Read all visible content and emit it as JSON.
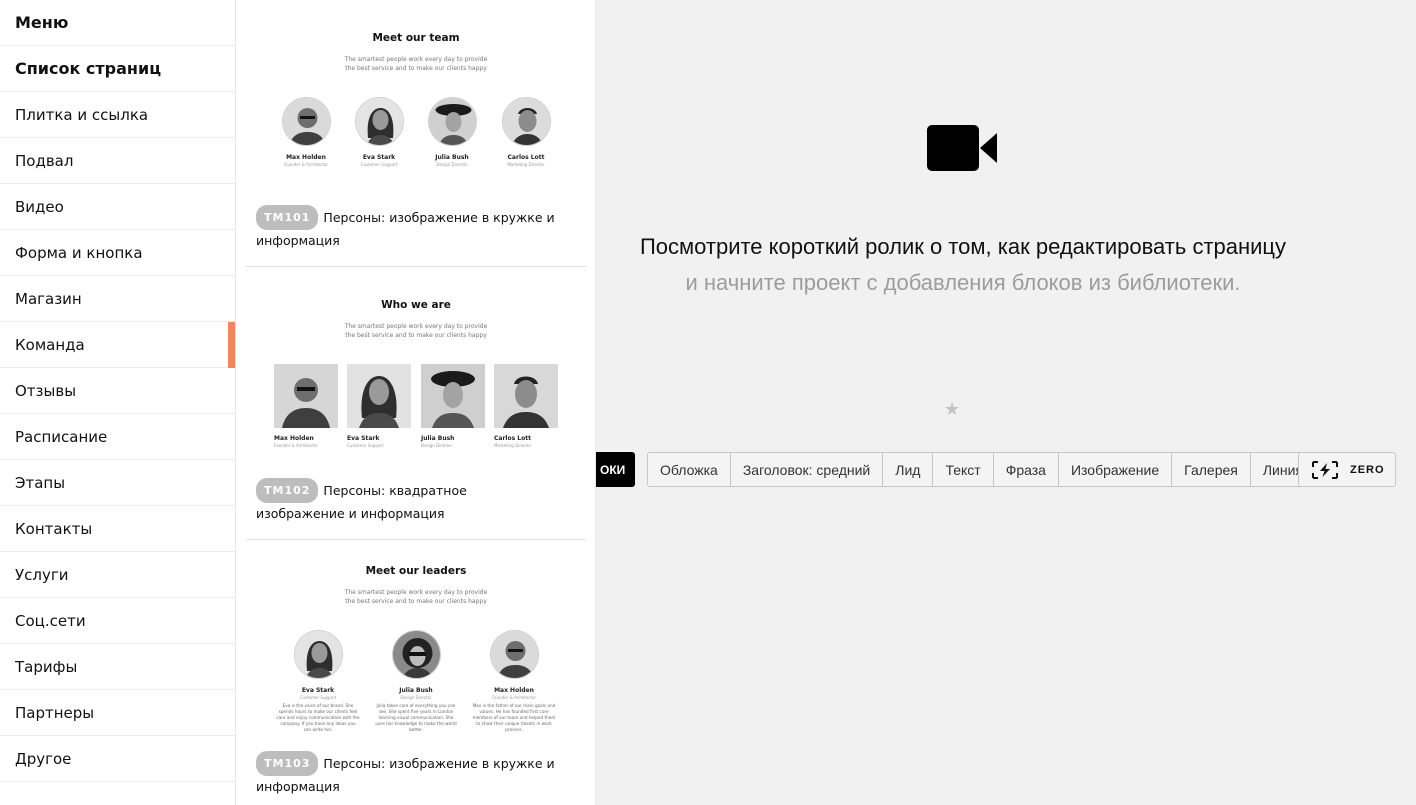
{
  "menu": {
    "items": [
      {
        "label": "Меню"
      },
      {
        "label": "Список страниц"
      },
      {
        "label": "Плитка и ссылка"
      },
      {
        "label": "Подвал"
      },
      {
        "label": "Видео"
      },
      {
        "label": "Форма и кнопка"
      },
      {
        "label": "Магазин"
      },
      {
        "label": "Команда"
      },
      {
        "label": "Отзывы"
      },
      {
        "label": "Расписание"
      },
      {
        "label": "Этапы"
      },
      {
        "label": "Контакты"
      },
      {
        "label": "Услуги"
      },
      {
        "label": "Соц.сети"
      },
      {
        "label": "Тарифы"
      },
      {
        "label": "Партнеры"
      },
      {
        "label": "Другое"
      }
    ],
    "active_item": "Команда",
    "accent_color": "#f4845f"
  },
  "library": {
    "cards": [
      {
        "preview_title": "Meet our team",
        "preview_subtitle": "The smartest people work every day to provide the best service and to make our clients happy",
        "people": [
          {
            "name": "Max Holden",
            "role": "Founder & Architector"
          },
          {
            "name": "Eva Stark",
            "role": "Customer Support"
          },
          {
            "name": "Julia Bush",
            "role": "Design Director"
          },
          {
            "name": "Carlos Lott",
            "role": "Marketing Director"
          }
        ],
        "code": "TM101",
        "label": "Персоны: изображение в кружке и информация"
      },
      {
        "preview_title": "Who we are",
        "preview_subtitle": "The smartest people work every day to provide the best service and to make our clients happy",
        "people": [
          {
            "name": "Max Holden",
            "role": "Founder & Architector"
          },
          {
            "name": "Eva Stark",
            "role": "Customer Support"
          },
          {
            "name": "Julia Bush",
            "role": "Design Director"
          },
          {
            "name": "Carlos Lott",
            "role": "Marketing Director"
          }
        ],
        "code": "TM102",
        "label": "Персоны: квадратное изображение и информация"
      },
      {
        "preview_title": "Meet our leaders",
        "preview_subtitle": "The smartest people work every day to provide the best service and to make our clients happy",
        "people": [
          {
            "name": "Eva Stark",
            "role": "Customer Support",
            "desc": "Eva is the voice of our brand. She spends hours to make our clients feel care and enjoy communication with the company. If you have any ideas you can write her."
          },
          {
            "name": "Julia Bush",
            "role": "Design Director",
            "desc": "Julia takes care of everything you can see. She spent five years in London learning visual communication. She uses her knowledge to make the world better."
          },
          {
            "name": "Max Holden",
            "role": "Founder & Architector",
            "desc": "Max is the father of our main goals and values. He has founded first core members of our team and helped them to show their unique talents in work process."
          }
        ],
        "code": "TM103",
        "label": "Персоны: изображение в кружке и информация"
      }
    ]
  },
  "main": {
    "video_icon": "video-camera-icon",
    "headline": "Посмотрите короткий ролик о том, как редактировать страницу",
    "subline": "и начните проект с добавления блоков из библиотеки.",
    "star_icon": "star-icon",
    "all_blocks_label": "ОКИ",
    "chips": [
      "Обложка",
      "Заголовок: средний",
      "Лид",
      "Текст",
      "Фраза",
      "Изображение",
      "Галерея",
      "Линия"
    ],
    "zero_label": "ZERO",
    "zero_icon": "zero-block-bolt-icon"
  }
}
